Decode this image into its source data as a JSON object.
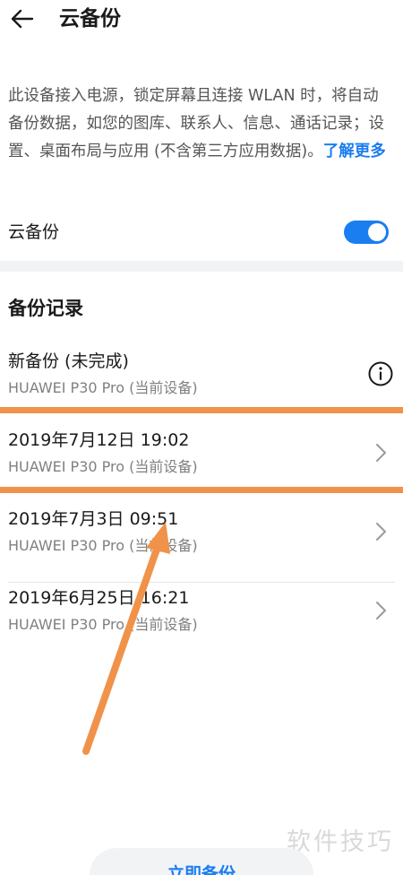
{
  "header": {
    "title": "云备份"
  },
  "description": {
    "text": "此设备接入电源，锁定屏幕且连接 WLAN 时，将自动备份数据，如您的图库、联系人、信息、通话记录；设置、桌面布局与应用 (不含第三方应用数据)。",
    "link": "了解更多"
  },
  "toggle": {
    "label": "云备份",
    "on": true
  },
  "section": {
    "title": "备份记录"
  },
  "records": [
    {
      "title": "新备份 (未完成)",
      "subtitle": "HUAWEI P30 Pro (当前设备)",
      "icon": "info-icon"
    },
    {
      "title": "2019年7月12日 19:02",
      "subtitle": "HUAWEI P30 Pro (当前设备)",
      "icon": "chevron-right-icon"
    },
    {
      "title": "2019年7月3日 09:51",
      "subtitle": "HUAWEI P30 Pro (当前设备)",
      "icon": "chevron-right-icon"
    },
    {
      "title": "2019年6月25日 16:21",
      "subtitle": "HUAWEI P30 Pro (当前设备)",
      "icon": "chevron-right-icon"
    }
  ],
  "bottom": {
    "button_label": "立即备份",
    "watermark": "软件技巧"
  },
  "colors": {
    "accent": "#1a7df0",
    "highlight": "#f0924a",
    "secondary_text": "#808080"
  }
}
